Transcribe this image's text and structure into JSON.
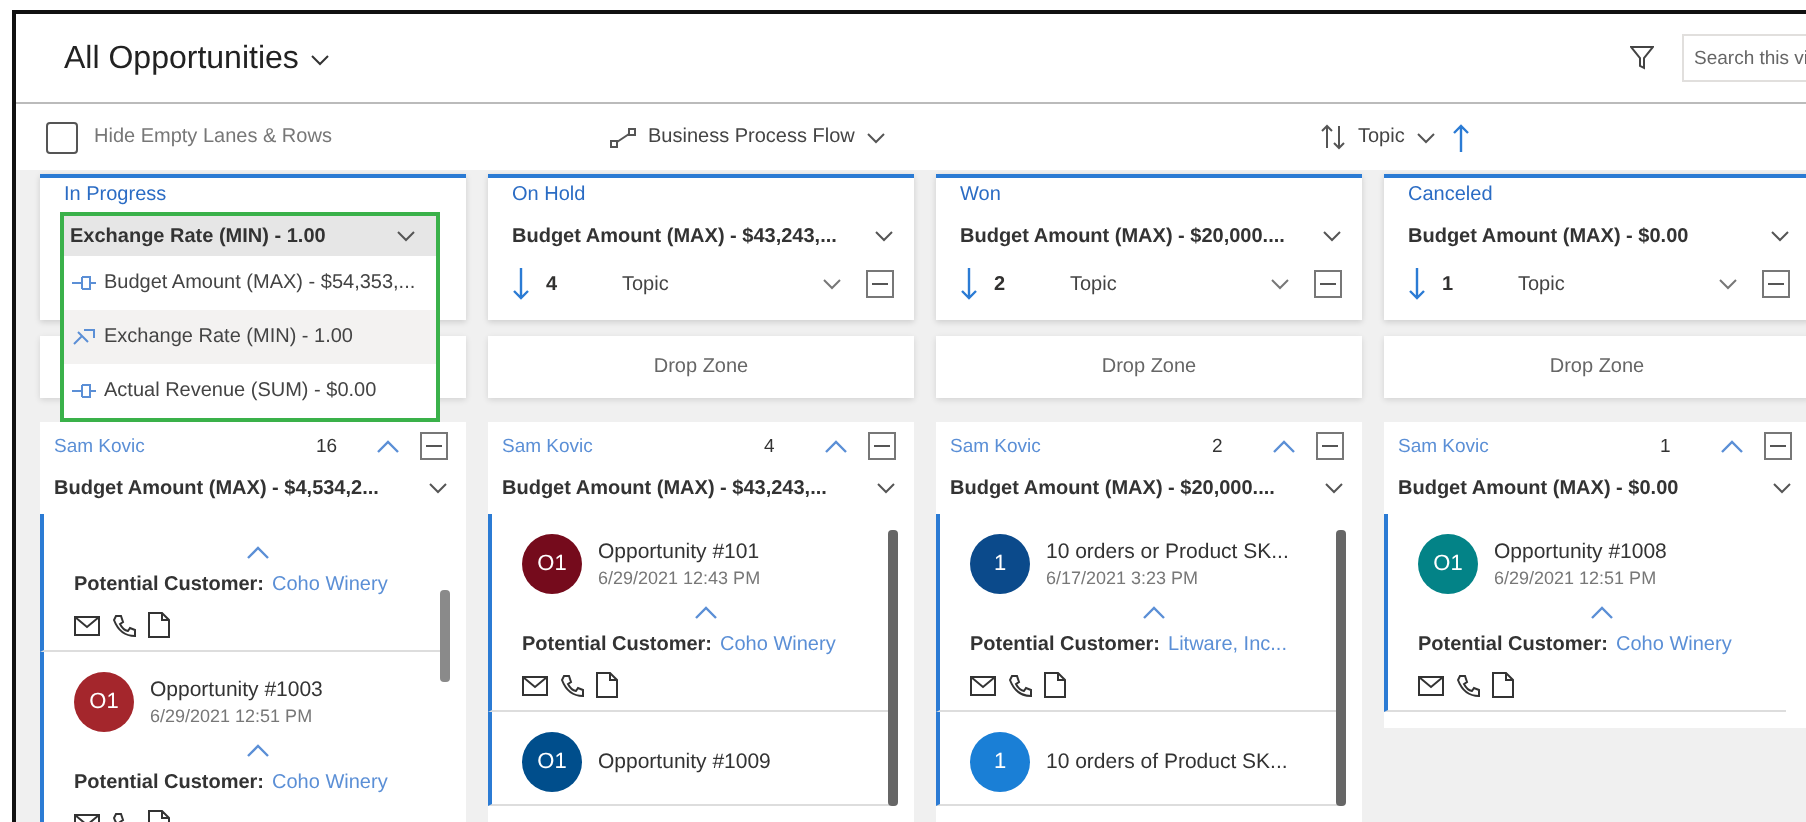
{
  "view": {
    "title": "All Opportunities"
  },
  "search": {
    "placeholder": "Search this vi"
  },
  "toolbar": {
    "hide_empty": {
      "label": "Hide Empty Lanes & Rows",
      "checked": false
    },
    "process_flow": "Business Process Flow",
    "sort_field": "Topic"
  },
  "lanes": [
    {
      "title": "In Progress",
      "aggregate": "Exchange Rate (MIN) - 1.00",
      "expanded": true,
      "options": [
        {
          "label": "Budget Amount (MAX) - $54,353,...",
          "selected": false
        },
        {
          "label": "Exchange Rate (MIN) - 1.00",
          "selected": true
        },
        {
          "label": "Actual Revenue (SUM) - $0.00",
          "selected": false
        }
      ],
      "row": {
        "owner": "Sam Kovic",
        "count": "16",
        "aggregate": "Budget Amount (MAX) - $4,534,2..."
      },
      "cards": [
        {
          "customer_label": "Potential Customer:",
          "customer": "Coho Winery"
        },
        {
          "avatar": "O1",
          "color": "#a4262c",
          "title": "Opportunity #1003",
          "date": "6/29/2021 12:51 PM",
          "customer_label": "Potential Customer:",
          "customer": "Coho Winery"
        }
      ]
    },
    {
      "title": "On Hold",
      "aggregate": "Budget Amount (MAX) - $43,243,...",
      "expanded": false,
      "sort_count": "4",
      "sort_field": "Topic",
      "drop_zone": "Drop Zone",
      "row": {
        "owner": "Sam Kovic",
        "count": "4",
        "aggregate": "Budget Amount (MAX) - $43,243,..."
      },
      "cards": [
        {
          "avatar": "O1",
          "color": "#750b1c",
          "title": "Opportunity #101",
          "date": "6/29/2021 12:43 PM",
          "customer_label": "Potential Customer:",
          "customer": "Coho Winery"
        },
        {
          "avatar": "O1",
          "color": "#004e8c",
          "title": "Opportunity #1009"
        }
      ]
    },
    {
      "title": "Won",
      "aggregate": "Budget Amount (MAX) - $20,000....",
      "expanded": false,
      "sort_count": "2",
      "sort_field": "Topic",
      "drop_zone": "Drop Zone",
      "row": {
        "owner": "Sam Kovic",
        "count": "2",
        "aggregate": "Budget Amount (MAX) - $20,000...."
      },
      "cards": [
        {
          "avatar": "1",
          "color": "#0b4a8b",
          "title": "10 orders or Product SK...",
          "date": "6/17/2021 3:23 PM",
          "customer_label": "Potential Customer:",
          "customer": "Litware, Inc..."
        },
        {
          "avatar": "1",
          "color": "#1a7fd6",
          "title": "10 orders of Product SK..."
        }
      ]
    },
    {
      "title": "Canceled",
      "aggregate": "Budget Amount (MAX) - $0.00",
      "expanded": false,
      "sort_count": "1",
      "sort_field": "Topic",
      "drop_zone": "Drop Zone",
      "row": {
        "owner": "Sam Kovic",
        "count": "1",
        "aggregate": "Budget Amount (MAX) - $0.00"
      },
      "cards": [
        {
          "avatar": "O1",
          "color": "#038387",
          "title": "Opportunity #1008",
          "date": "6/29/2021 12:51 PM",
          "customer_label": "Potential Customer:",
          "customer": "Coho Winery"
        }
      ]
    }
  ]
}
